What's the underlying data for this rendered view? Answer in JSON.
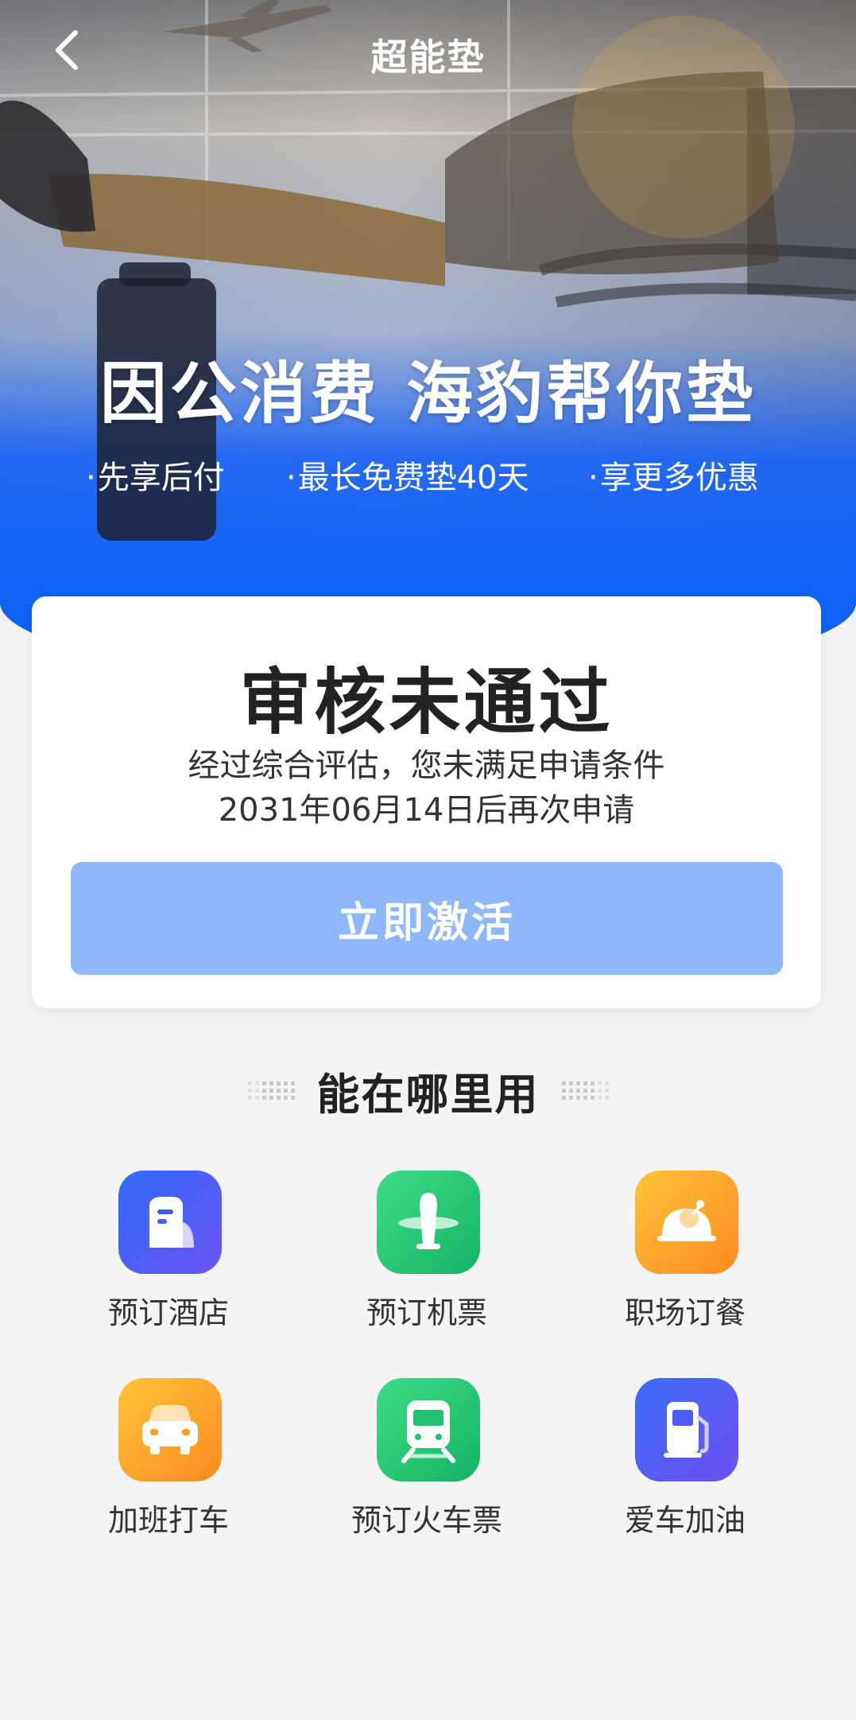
{
  "nav": {
    "title": "超能垫",
    "back_icon": "chevron-left-icon"
  },
  "hero": {
    "slogan": "因公消费 海豹帮你垫",
    "features": [
      "先享后付",
      "最长免费垫40天",
      "享更多优惠"
    ]
  },
  "status_card": {
    "title": "审核未通过",
    "line1": "经过综合评估，您未满足申请条件",
    "line2": "2031年06月14日后再次申请",
    "button_label": "立即激活"
  },
  "usage_section": {
    "title": "能在哪里用",
    "services": [
      {
        "label": "预订酒店",
        "icon": "hotel-icon"
      },
      {
        "label": "预订机票",
        "icon": "airplane-icon"
      },
      {
        "label": "职场订餐",
        "icon": "meal-icon"
      },
      {
        "label": "加班打车",
        "icon": "taxi-icon"
      },
      {
        "label": "预订火车票",
        "icon": "train-icon"
      },
      {
        "label": "爱车加油",
        "icon": "fuel-icon"
      }
    ]
  },
  "colors": {
    "primary_blue": "#0f62f6",
    "button_disabled": "#8fb7fb",
    "background": "#f4f4f4"
  }
}
